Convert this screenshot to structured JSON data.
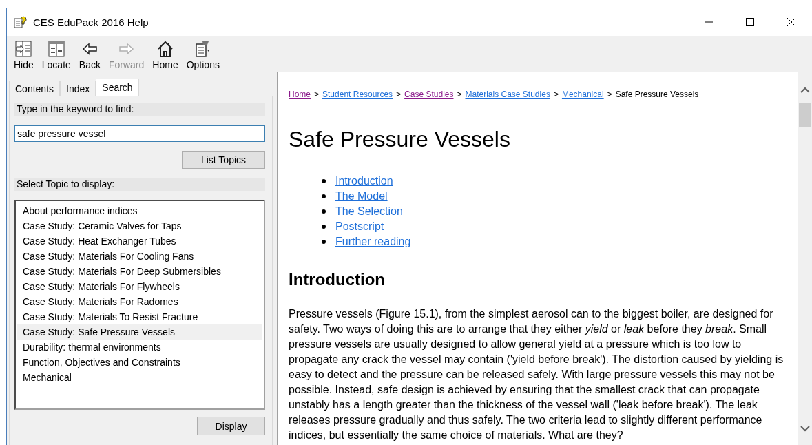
{
  "window": {
    "title": "CES EduPack 2016 Help"
  },
  "toolbar": [
    {
      "kind": "hide",
      "label": "Hide",
      "disabled": false
    },
    {
      "kind": "locate",
      "label": "Locate",
      "disabled": false
    },
    {
      "kind": "back",
      "label": "Back",
      "disabled": false
    },
    {
      "kind": "forward",
      "label": "Forward",
      "disabled": true
    },
    {
      "kind": "home",
      "label": "Home",
      "disabled": false
    },
    {
      "kind": "options",
      "label": "Options",
      "disabled": false
    }
  ],
  "tabs": [
    {
      "label": "Contents",
      "selected": false
    },
    {
      "label": "Index",
      "selected": false
    },
    {
      "label": "Search",
      "selected": true
    }
  ],
  "search": {
    "keyword_label": "Type in the keyword to find:",
    "value": "safe pressure vessel",
    "list_button": "List Topics",
    "topic_label": "Select Topic to display:",
    "topics": [
      {
        "label": "About performance indices",
        "selected": false
      },
      {
        "label": "Case Study: Ceramic Valves for Taps",
        "selected": false
      },
      {
        "label": "Case Study: Heat Exchanger Tubes",
        "selected": false
      },
      {
        "label": "Case Study: Materials For Cooling Fans",
        "selected": false
      },
      {
        "label": "Case Study: Materials For Deep Submersibles",
        "selected": false
      },
      {
        "label": "Case Study: Materials For Flywheels",
        "selected": false
      },
      {
        "label": "Case Study: Materials For Radomes",
        "selected": false
      },
      {
        "label": "Case Study: Materials To Resist Fracture",
        "selected": false
      },
      {
        "label": "Case Study: Safe Pressure Vessels",
        "selected": true
      },
      {
        "label": "Durability: thermal environments",
        "selected": false
      },
      {
        "label": "Function, Objectives and Constraints",
        "selected": false
      },
      {
        "label": "Mechanical",
        "selected": false
      }
    ],
    "display_button": "Display"
  },
  "page": {
    "breadcrumb": [
      {
        "label": "Home",
        "visited": true
      },
      {
        "label": "Student Resources",
        "visited": false
      },
      {
        "label": "Case Studies",
        "visited": true
      },
      {
        "label": "Materials Case Studies",
        "visited": false
      },
      {
        "label": "Mechanical",
        "visited": false
      }
    ],
    "separator": ">",
    "current": "Safe Pressure Vessels",
    "title": "Safe Pressure Vessels",
    "contents": [
      "Introduction",
      "The Model",
      "The Selection",
      "Postscript",
      "Further reading"
    ],
    "section_heading": "Introduction",
    "paragraph": "Pressure vessels (Figure 15.1), from the simplest aerosol can to the biggest boiler, are designed for safety. Two ways of doing this are to arrange that they either *yield* or *leak* before they *break*. Small pressure vessels are usually designed to allow general yield at a pressure which is too low to propagate any crack the vessel may contain ('yield before break'). The distortion caused by yielding is easy to detect and the pressure can be released safely. With large pressure vessels this may not be possible. Instead, safe design is achieved by ensuring that the smallest crack that can propagate unstably has a length greater than the thickness of the vessel wall ('leak before break'). The leak releases pressure gradually and thus safely. The two criteria lead to slightly different performance indices, but essentially the same choice of materials. What are they?"
  }
}
